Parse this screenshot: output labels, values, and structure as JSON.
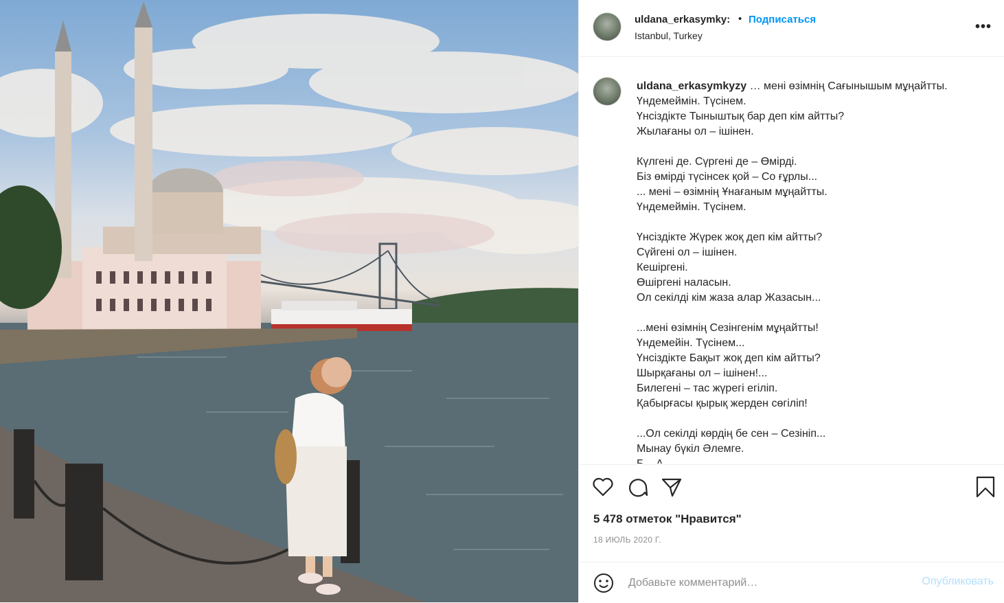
{
  "post": {
    "image_alt": "Фото",
    "author": {
      "username_short": "uldana_erkasymky:",
      "username": "uldana_erkasymkyzy",
      "location": "Istanbul, Turkey"
    },
    "header": {
      "dot": "•",
      "follow_label": "Подписаться",
      "more": "•••"
    },
    "caption_text": "… мені өзімнің Сағынышым мұңайтты.\nҮндемеймін. Түсінем.\nҮнсіздікте Тыныштық бар деп кім айтты?\nЖылағаны ол – ішінен.\n\nКүлгені де. Сүргені де – Өмірді.\nБіз өмірді түсінсек қой – Со ғұрлы...\n... мені – өзімнің Ұнағаным мұңайтты.\nҮндемеймін. Түсінем.\n\nҮнсіздікте Жүрек жоқ деп кім айтты?\nСүйгені ол – ішінен.\nКешіргені.\nӨшіргені наласын.\nОл секілді кім жаза алар Жазасын...\n\n...мені өзімнің Сезінгенім мұңайтты!\nҮндемейін. Түсінем...\nҮнсіздікте Бақыт жоқ деп кім айтты?\nШырқағаны ол – ішінен!...\nБилегені – тас жүрегі егіліп.\nҚабырғасы қырық жерден сөгіліп!\n\n...Ол секілді көрдің бе сен – Сезініп...\nМынау бүкіл Әлемге.\nБ... А...",
    "likes": "5 478 отметок \"Нравится\"",
    "date": "18 ИЮЛЬ 2020 Г.",
    "comment_placeholder": "Добавьте комментарий…",
    "publish_label": "Опубликовать"
  },
  "icons": {
    "like": "heart-icon",
    "comment": "comment-icon",
    "share": "share-icon",
    "save": "bookmark-icon",
    "emoji": "smiley-icon",
    "more": "more-icon"
  },
  "colors": {
    "link": "#0095f6",
    "publish_disabled": "#b2dffc",
    "meta": "#8e8e8e"
  }
}
